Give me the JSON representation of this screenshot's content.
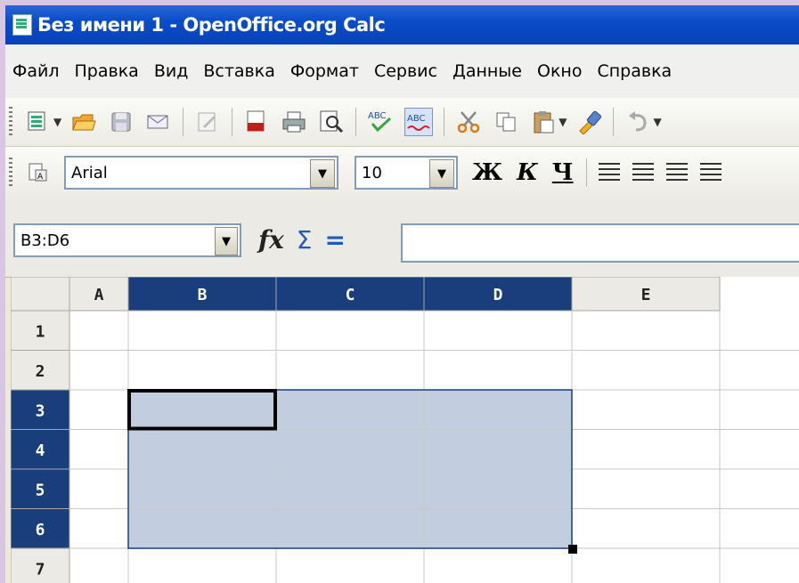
{
  "window": {
    "title": "Без имени 1 - OpenOffice.org Calc"
  },
  "menu": [
    "Файл",
    "Правка",
    "Вид",
    "Вставка",
    "Формат",
    "Сервис",
    "Данные",
    "Окно",
    "Справка"
  ],
  "toolbar_standard": {
    "icons": [
      "new-document-icon",
      "open-folder-icon",
      "save-icon",
      "email-icon",
      "edit-file-icon",
      "export-pdf-icon",
      "print-icon",
      "page-preview-icon",
      "spellcheck-icon",
      "autospellcheck-icon",
      "cut-icon",
      "copy-icon",
      "paste-icon",
      "clone-formatting-icon",
      "undo-icon"
    ]
  },
  "toolbar_formatting": {
    "font_name": "Arial",
    "font_size": "10",
    "bold_label": "Ж",
    "italic_label": "К",
    "underline_label": "Ч"
  },
  "formula_bar": {
    "name_box": "B3:D6",
    "fx": "fx",
    "sum": "Σ",
    "equals": "=",
    "input_value": ""
  },
  "sheet": {
    "columns": [
      "A",
      "B",
      "C",
      "D",
      "E"
    ],
    "rows": [
      "1",
      "2",
      "3",
      "4",
      "5",
      "6",
      "7"
    ],
    "selected_columns": [
      "B",
      "C",
      "D"
    ],
    "selected_rows": [
      "3",
      "4",
      "5",
      "6"
    ],
    "selection_range": "B3:D6",
    "active_cell": "B3",
    "colors": {
      "header_selected": "#1a3d7c",
      "selection_fill": "#c3cde0",
      "header_bg": "#eceae4"
    }
  }
}
